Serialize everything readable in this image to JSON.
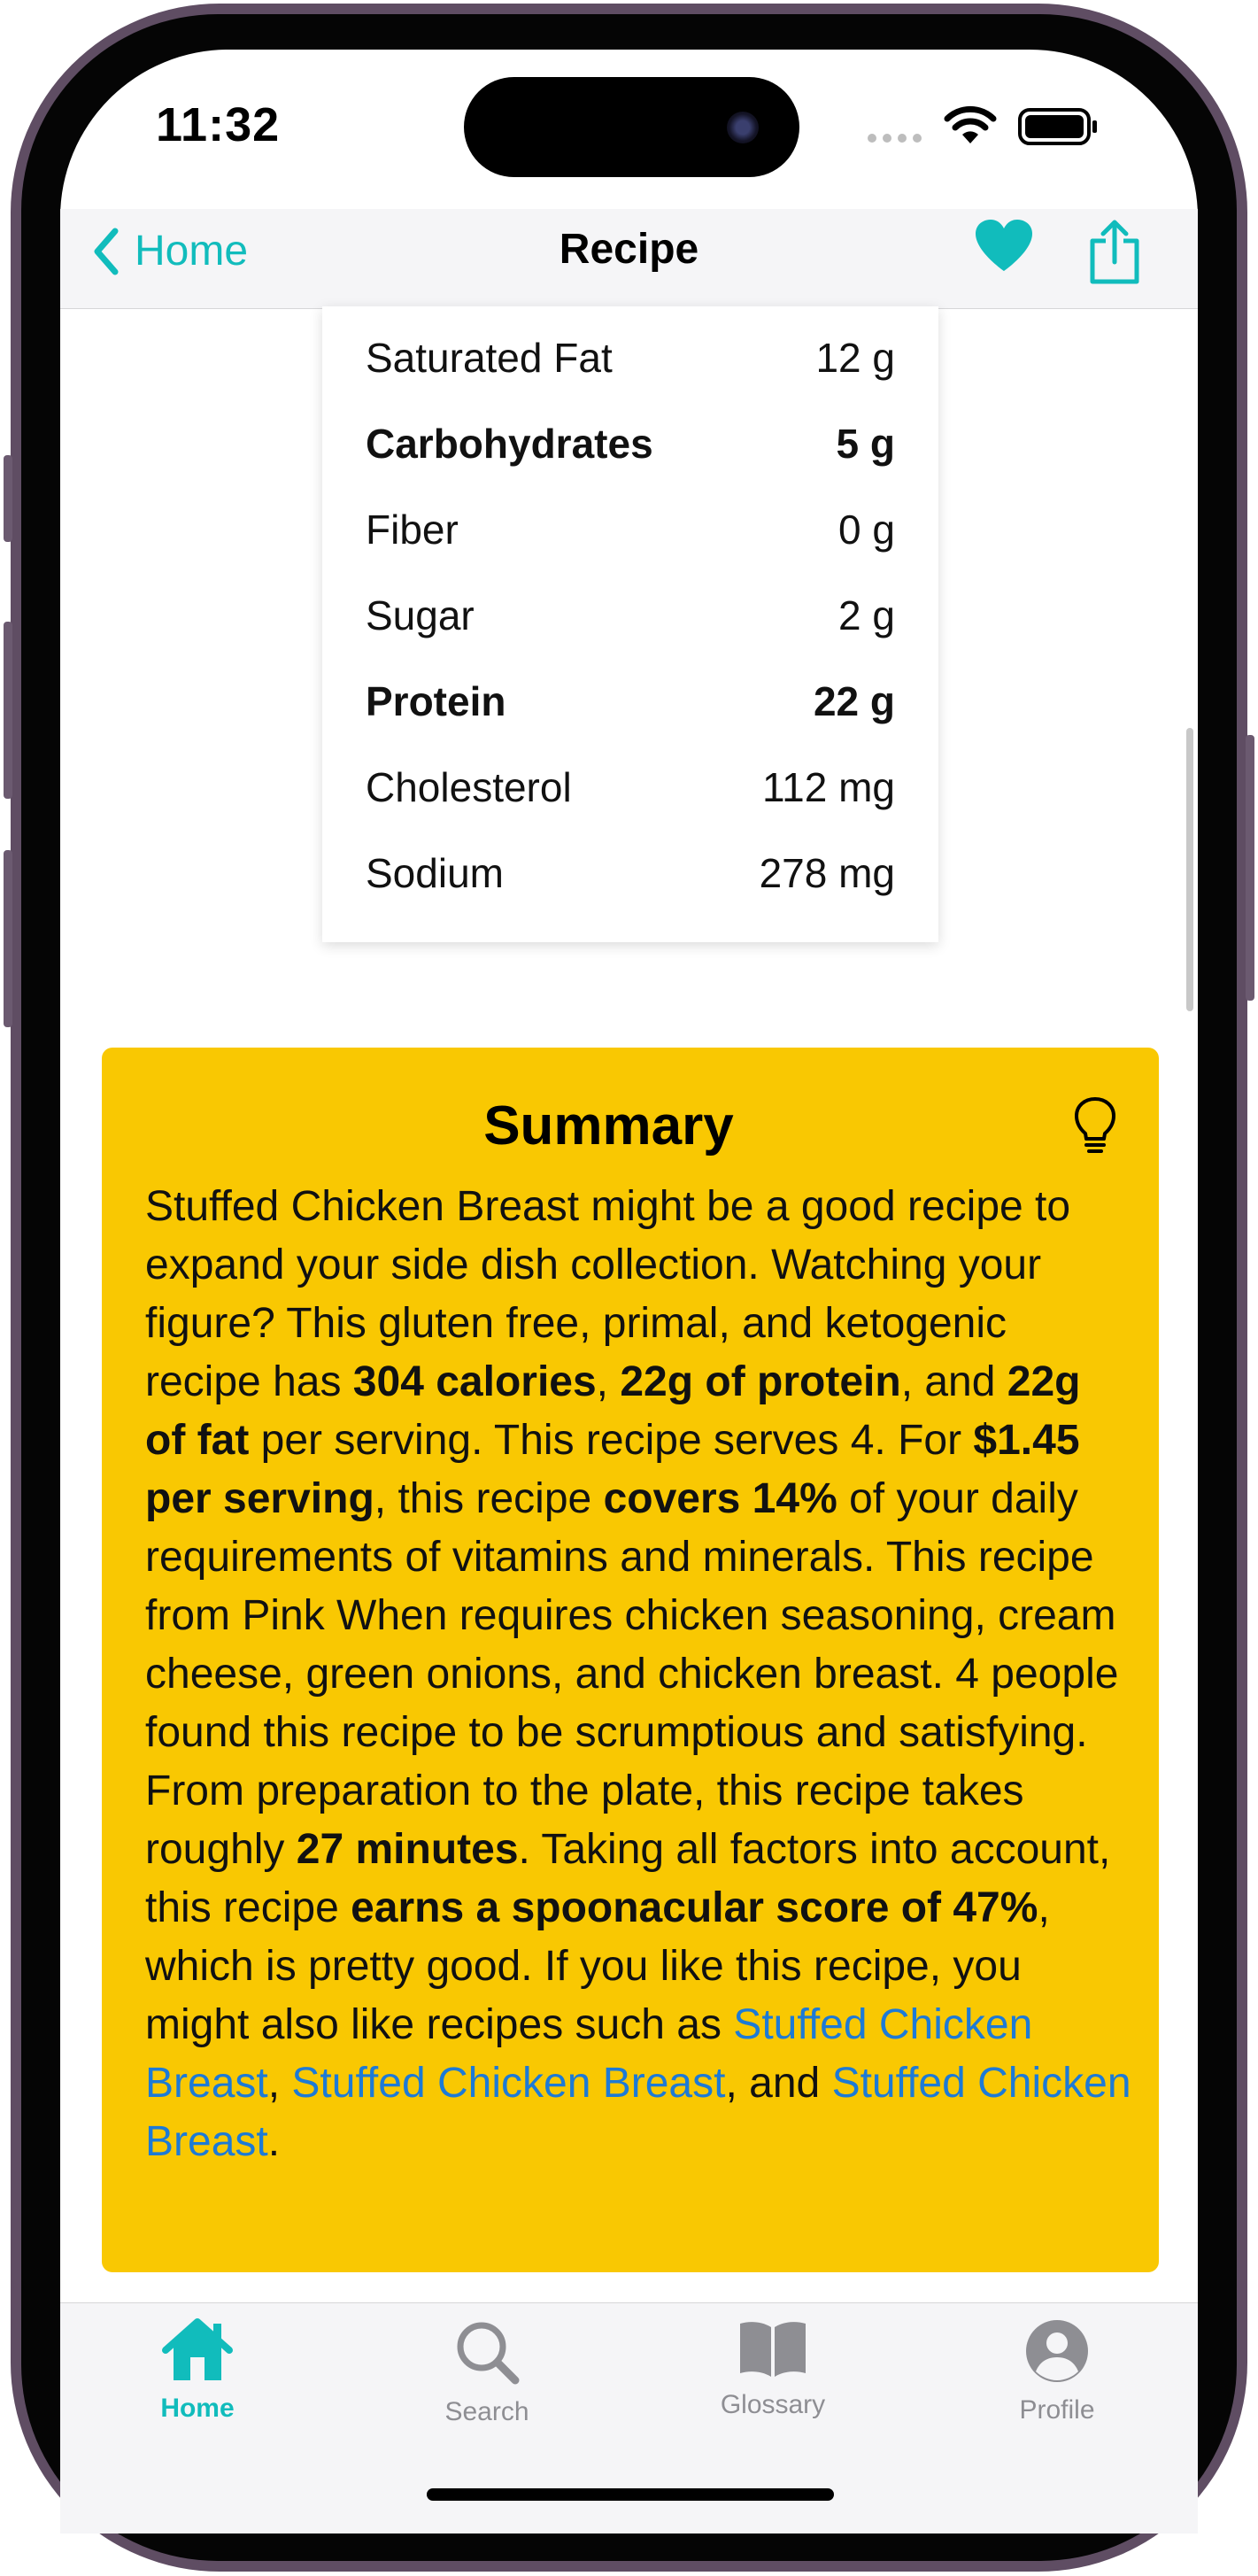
{
  "status_bar": {
    "time": "11:32"
  },
  "nav": {
    "back_label": "Home",
    "title": "Recipe"
  },
  "nutrition": {
    "rows": [
      {
        "label": "Saturated Fat",
        "value": "12 g",
        "bold": false
      },
      {
        "label": "Carbohydrates",
        "value": "5 g",
        "bold": true
      },
      {
        "label": "Fiber",
        "value": "0 g",
        "bold": false
      },
      {
        "label": "Sugar",
        "value": "2 g",
        "bold": false
      },
      {
        "label": "Protein",
        "value": "22 g",
        "bold": true
      },
      {
        "label": "Cholesterol",
        "value": "112 mg",
        "bold": false
      },
      {
        "label": "Sodium",
        "value": "278 mg",
        "bold": false
      }
    ]
  },
  "summary": {
    "title": "Summary",
    "segments": [
      {
        "t": "Stuffed Chicken Breast might be a good recipe to expand your side dish collection. Watching your figure? This gluten free, primal, and ketogenic recipe has "
      },
      {
        "t": "304 calories",
        "b": true
      },
      {
        "t": ", "
      },
      {
        "t": "22g of protein",
        "b": true
      },
      {
        "t": ", and "
      },
      {
        "t": "22g of fat",
        "b": true
      },
      {
        "t": " per serving. This recipe serves 4. For "
      },
      {
        "t": "$1.45 per serving",
        "b": true
      },
      {
        "t": ", this recipe "
      },
      {
        "t": "covers 14%",
        "b": true
      },
      {
        "t": " of your daily requirements of vitamins and minerals. This recipe from Pink When requires chicken seasoning, cream cheese, green onions, and chicken breast. 4 people found this recipe to be scrumptious and satisfying. From preparation to the plate, this recipe takes roughly "
      },
      {
        "t": "27 minutes",
        "b": true
      },
      {
        "t": ". Taking all factors into account, this recipe "
      },
      {
        "t": "earns a spoonacular score of 47%",
        "b": true
      },
      {
        "t": ", which is pretty good. If you like this recipe, you might also like recipes such as "
      },
      {
        "t": "Stuffed Chicken Breast",
        "link": true
      },
      {
        "t": ", "
      },
      {
        "t": "Stuffed Chicken Breast",
        "link": true
      },
      {
        "t": ", and "
      },
      {
        "t": "Stuffed Chicken Breast",
        "link": true
      },
      {
        "t": "."
      }
    ]
  },
  "tabs": [
    {
      "label": "Home",
      "icon": "house-icon",
      "active": true
    },
    {
      "label": "Search",
      "icon": "magnifier-icon",
      "active": false
    },
    {
      "label": "Glossary",
      "icon": "book-icon",
      "active": false
    },
    {
      "label": "Profile",
      "icon": "person-circle-icon",
      "active": false
    }
  ],
  "colors": {
    "accent": "#11bcbc",
    "summary_bg": "#f9c802",
    "link": "#1d7ad6"
  }
}
